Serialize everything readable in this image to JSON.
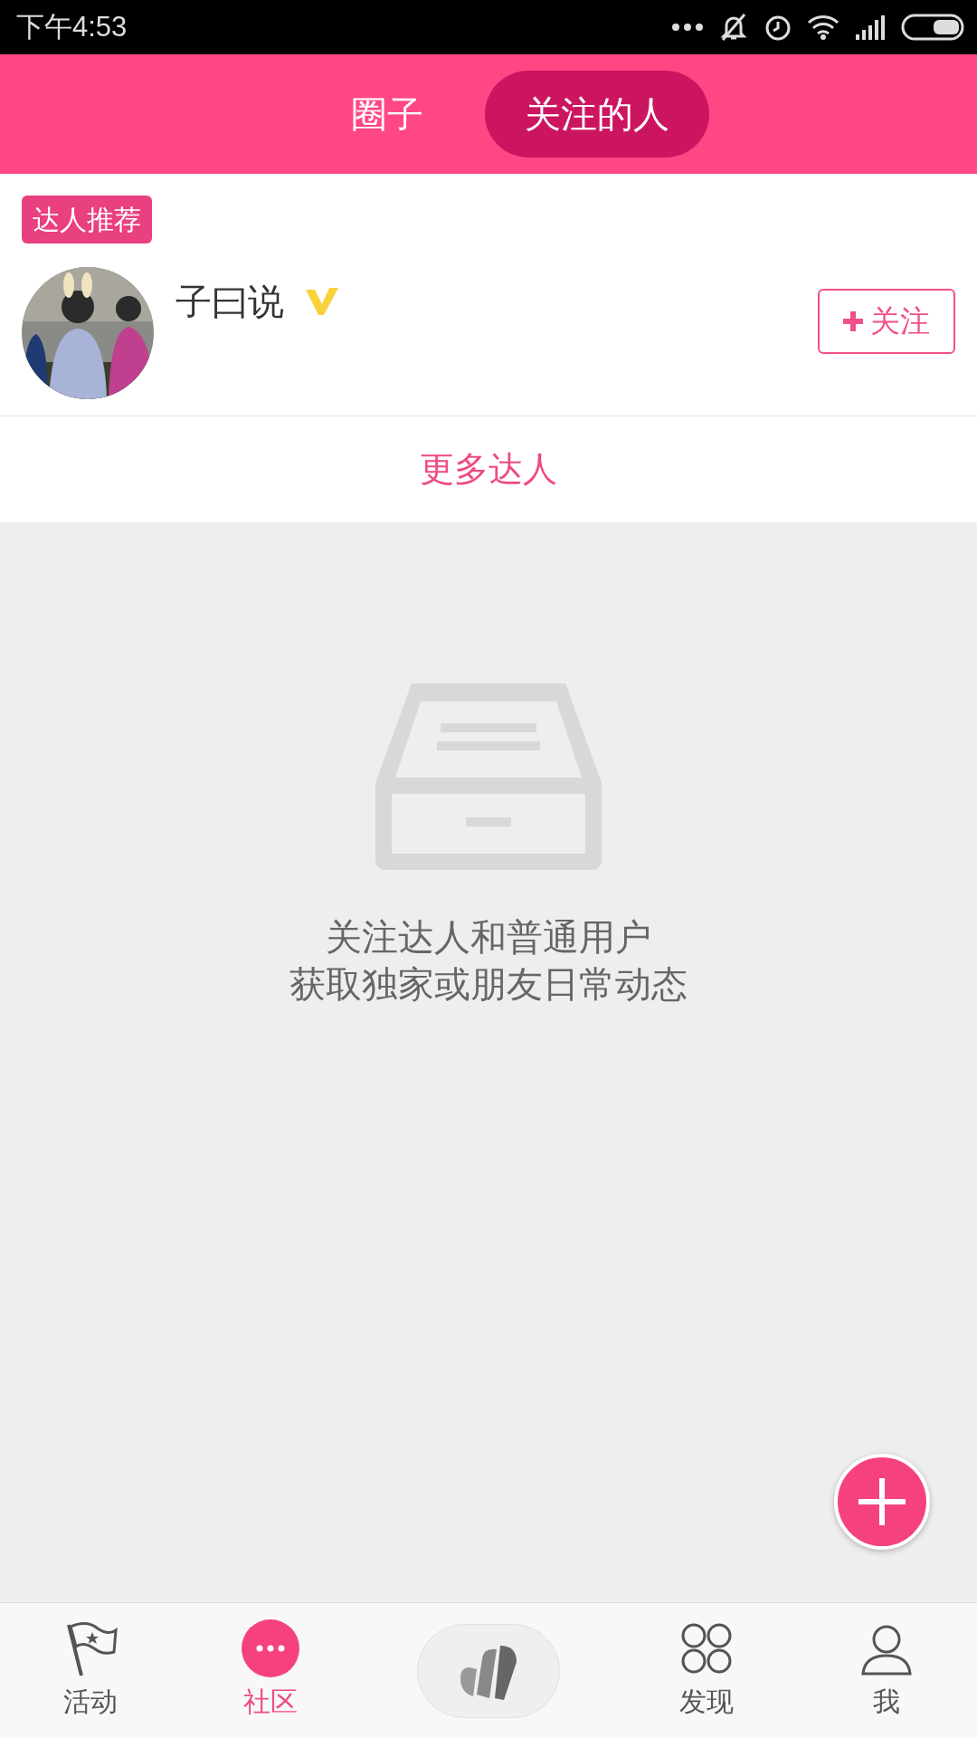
{
  "status_bar": {
    "time": "下午4:53"
  },
  "tabs": [
    {
      "label": "圈子",
      "selected": false
    },
    {
      "label": "关注的人",
      "selected": true
    }
  ],
  "recommend": {
    "badge": "达人推荐",
    "users": [
      {
        "name": "子曰说",
        "verified": true,
        "follow_label": "关注"
      }
    ],
    "more": "更多达人"
  },
  "empty": {
    "lines": [
      "关注达人和普通用户",
      "获取独家或朋友日常动态"
    ]
  },
  "bottom_nav": [
    {
      "kind": "flag",
      "label": "活动",
      "selected": false
    },
    {
      "kind": "dots",
      "label": "社区",
      "selected": true
    },
    {
      "kind": "center",
      "selected": false
    },
    {
      "kind": "circles",
      "label": "发现",
      "selected": false
    },
    {
      "kind": "person",
      "label": "我",
      "selected": false
    }
  ]
}
